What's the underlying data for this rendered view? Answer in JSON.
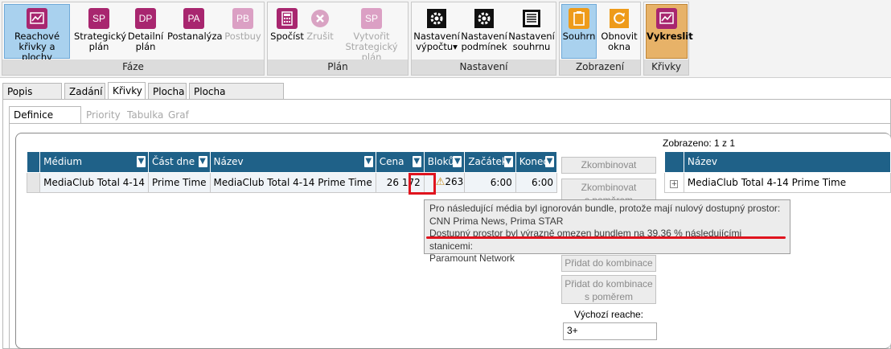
{
  "ribbon": {
    "faze": {
      "label": "Fáze",
      "buttons": [
        {
          "label1": "Reachové",
          "label2": "křivky a plochy",
          "icon": "chart-icon"
        },
        {
          "label1": "Strategický",
          "label2": "plán",
          "icon": "SP"
        },
        {
          "label1": "Detailní",
          "label2": "plán",
          "icon": "DP"
        },
        {
          "label1": "Postanalýza",
          "label2": "",
          "icon": "PA"
        },
        {
          "label1": "Postbuy",
          "label2": "",
          "icon": "PB"
        }
      ]
    },
    "plan": {
      "label": "Plán",
      "buttons": [
        {
          "label1": "Spočíst",
          "label2": "",
          "icon": "calculator-icon"
        },
        {
          "label1": "Zrušit",
          "label2": "",
          "icon": "cancel-icon"
        },
        {
          "label1": "Vytvořit",
          "label2": "Strategický plán",
          "icon": "SP"
        }
      ]
    },
    "nastaveni": {
      "label": "Nastavení",
      "buttons": [
        {
          "label1": "Nastavení",
          "label2": "výpočtu▾",
          "icon": "gear-icon"
        },
        {
          "label1": "Nastavení",
          "label2": "podmínek",
          "icon": "gear-icon"
        },
        {
          "label1": "Nastavení",
          "label2": "souhrnu",
          "icon": "summary-icon"
        }
      ]
    },
    "zobrazeni": {
      "label": "Zobrazení",
      "buttons": [
        {
          "label1": "Souhrn",
          "label2": "",
          "icon": "clipboard-icon"
        },
        {
          "label1": "Obnovit",
          "label2": "okna",
          "icon": "refresh-icon"
        }
      ]
    },
    "krivky": {
      "label": "Křivky",
      "buttons": [
        {
          "label1": "Vykreslit",
          "label2": "",
          "icon": "chart-icon"
        }
      ]
    }
  },
  "tabs_main": [
    "Popis plánu",
    "Zadání",
    "Křivky",
    "Plocha",
    "Plocha (požadavek)"
  ],
  "tabs_sub": [
    "Definice křivek",
    "Priority",
    "Tabulka",
    "Graf"
  ],
  "grid": {
    "headers": [
      "Médium",
      "Část dne",
      "Název",
      "Cena",
      "Bloků",
      "Začátek",
      "Konec"
    ],
    "rows": [
      {
        "medium": "MediaClub Total 4-14",
        "cast_dne": "Prime Time",
        "nazev": "MediaClub Total 4-14 Prime Time",
        "cena": "26 172",
        "bloku": "263",
        "zacatek": "6:00",
        "konec": "6:00"
      }
    ]
  },
  "tooltip": {
    "line1": "Pro následující média byl ignorován bundle, protože mají nulový dostupný prostor:",
    "line2": "CNN Prima News, Prima STAR",
    "line3": "Dostupný prostor byl výrazně omezen bundlem na 39,36 % následujícími stanicemi:",
    "line4": "Paramount Network"
  },
  "middle_buttons": {
    "zkombinovat": "Zkombinovat",
    "zkombinovat_pomer_1": "Zkombinovat",
    "zkombinovat_pomer_2": "s poměrem",
    "pridat": "Přidat do kombinace",
    "pridat_pomer_1": "Přidat do kombinace",
    "pridat_pomer_2": "s poměrem",
    "vychozi_label": "Výchozí reache:",
    "vychozi_value": "3+"
  },
  "right_grid": {
    "zobrazeno": "Zobrazeno: 1 z 1",
    "header": "Název",
    "rows": [
      "MediaClub Total 4-14 Prime Time"
    ],
    "expand": "+"
  },
  "colors": {
    "header_blue": "#1f6188",
    "magenta": "#a8266f",
    "highlight_red": "#e0141e",
    "selected_blue": "#a9d1ee",
    "selected_orange": "#e7b268"
  }
}
